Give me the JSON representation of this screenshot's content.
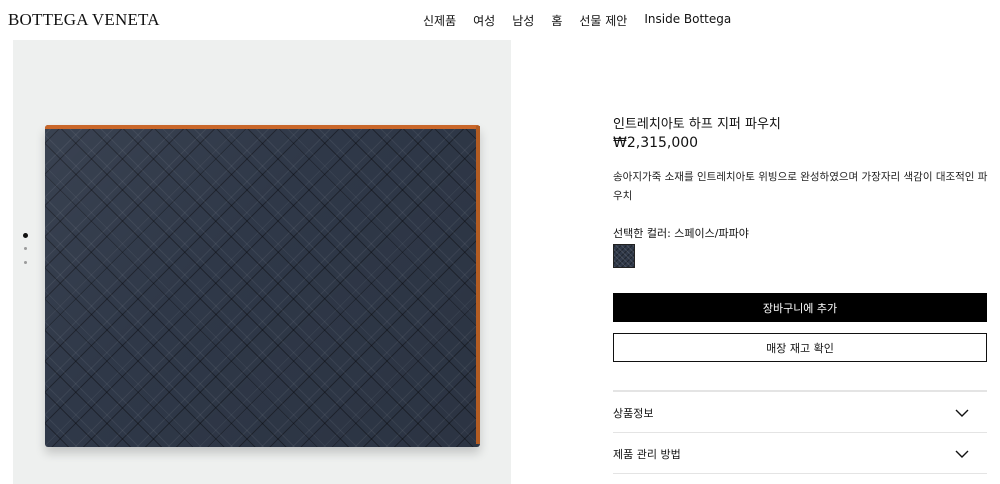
{
  "header": {
    "logo": "BOTTEGA VENETA",
    "nav": [
      "신제품",
      "여성",
      "남성",
      "홈",
      "선물 제안",
      "Inside Bottega"
    ]
  },
  "gallery": {
    "image_count": 3,
    "active_index": 0,
    "product_color": "#2f3848",
    "edge_color": "#c9672a",
    "background": "#eef0ef"
  },
  "product": {
    "title": "인트레치아토 하프 지퍼 파우치",
    "price": "₩2,315,000",
    "description": "송아지가죽 소재를 인트레치아토 위빙으로 완성하였으며 가장자리 색감이 대조적인 파우치",
    "color_label": "선택한 컬러: 스페이스/파파야",
    "add_to_cart": "장바구니에 추가",
    "check_stock": "매장 재고 확인"
  },
  "accordion": [
    {
      "label": "상품정보",
      "icon": "chevron-down-icon"
    },
    {
      "label": "제품 관리 방법",
      "icon": "chevron-down-icon"
    }
  ]
}
